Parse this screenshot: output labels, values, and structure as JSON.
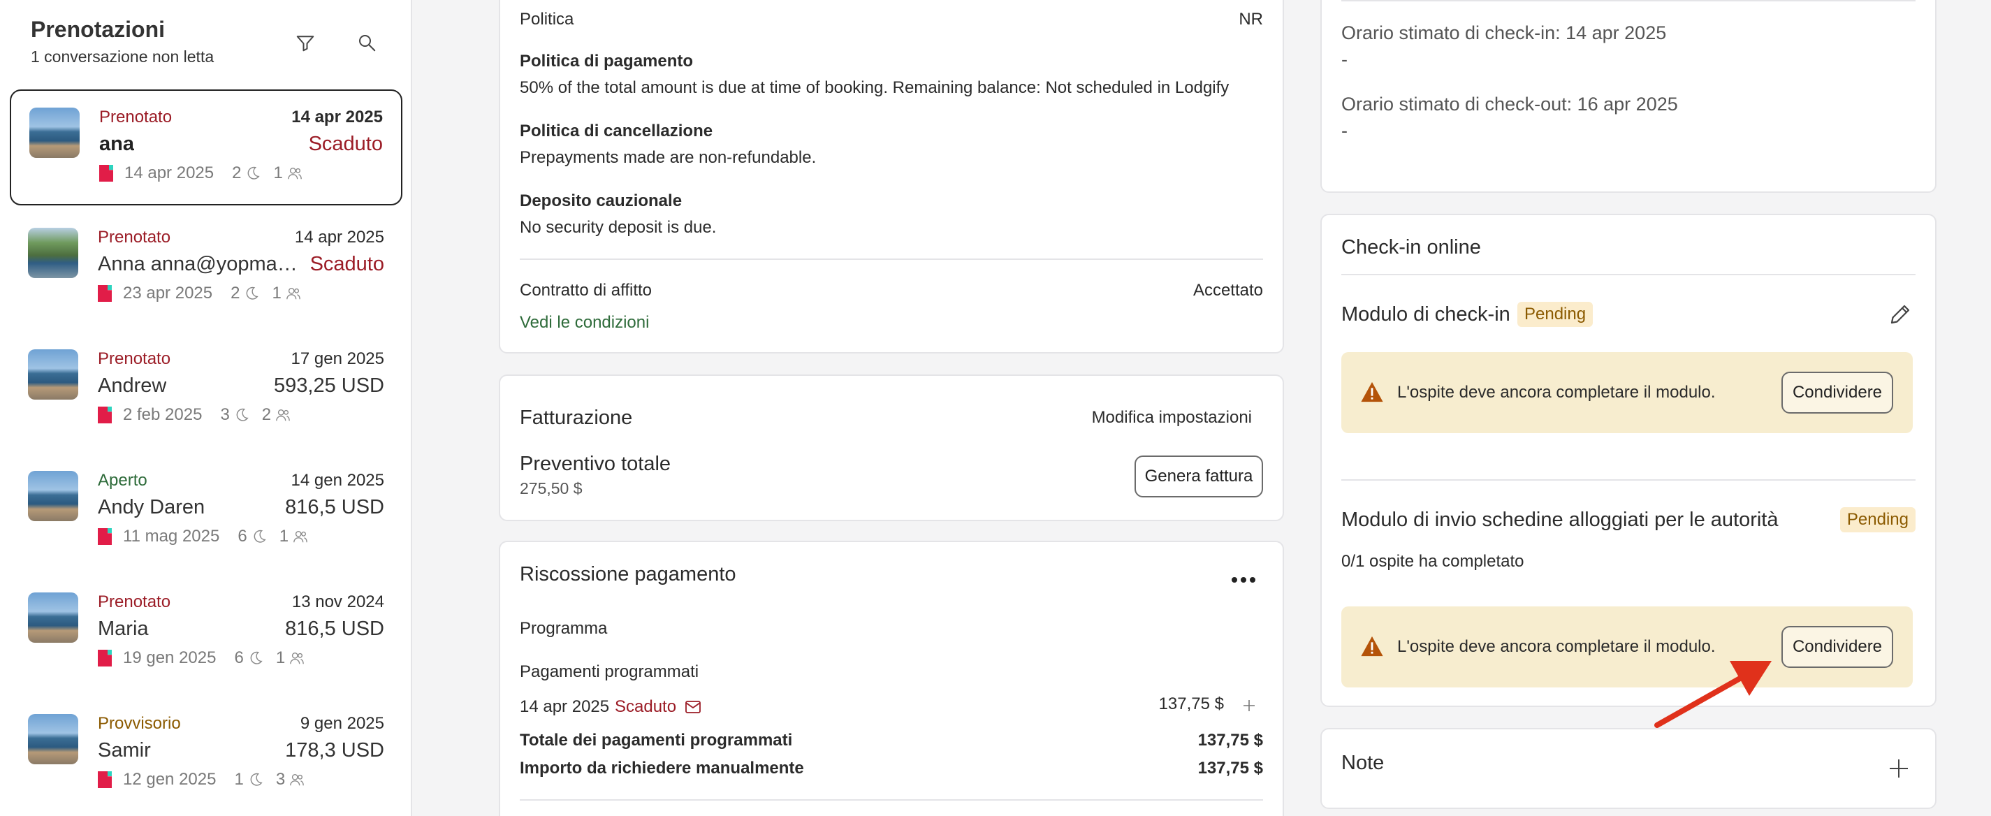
{
  "sidebar": {
    "title": "Prenotazioni",
    "subtitle": "1 conversazione non letta",
    "reservations": [
      {
        "status": "Prenotato",
        "date": "14 apr 2025",
        "guest": "ana",
        "amount": "Scaduto",
        "checkin": "14 apr 2025",
        "nights": "2",
        "guests": "1"
      },
      {
        "status": "Prenotato",
        "date": "14 apr 2025",
        "guest": "Anna anna@yopmail.com",
        "amount": "Scaduto",
        "checkin": "23 apr 2025",
        "nights": "2",
        "guests": "1"
      },
      {
        "status": "Prenotato",
        "date": "17 gen 2025",
        "guest": "Andrew",
        "amount": "593,25 USD",
        "checkin": "2 feb 2025",
        "nights": "3",
        "guests": "2"
      },
      {
        "status": "Aperto",
        "date": "14 gen 2025",
        "guest": "Andy Daren",
        "amount": "816,5 USD",
        "checkin": "11 mag 2025",
        "nights": "6",
        "guests": "1"
      },
      {
        "status": "Prenotato",
        "date": "13 nov 2024",
        "guest": "Maria",
        "amount": "816,5 USD",
        "checkin": "19 gen 2025",
        "nights": "6",
        "guests": "1"
      },
      {
        "status": "Provvisorio",
        "date": "9 gen 2025",
        "guest": "Samir",
        "amount": "178,3 USD",
        "checkin": "12 gen 2025",
        "nights": "1",
        "guests": "3"
      }
    ]
  },
  "policies": {
    "policy_label": "Politica",
    "policy_value": "NR",
    "payment_title": "Politica di pagamento",
    "payment_text": "50% of the total amount is due at time of booking. Remaining balance: Not scheduled in Lodgify",
    "cancel_title": "Politica di cancellazione",
    "cancel_text": "Prepayments made are non-refundable.",
    "deposit_title": "Deposito cauzionale",
    "deposit_text": "No security deposit is due.",
    "contract_label": "Contratto di affitto",
    "contract_value": "Accettato",
    "terms_link": "Vedi le condizioni"
  },
  "billing": {
    "title": "Fatturazione",
    "settings_link": "Modifica impostazioni",
    "quote_label": "Preventivo totale",
    "quote_value": "275,50 $",
    "invoice_button": "Genera fattura"
  },
  "payment": {
    "title": "Riscossione pagamento",
    "program_label": "Programma",
    "scheduled_label": "Pagamenti programmati",
    "row_date": "14 apr 2025",
    "row_status": "Scaduto",
    "row_amount": "137,75 $",
    "total_label": "Totale dei pagamenti programmati",
    "total_value": "137,75 $",
    "manual_label": "Importo da richiedere manualmente",
    "manual_value": "137,75 $"
  },
  "arrival": {
    "checkin_label": "Orario stimato di check-in: 14 apr 2025",
    "checkin_value": "-",
    "checkout_label": "Orario stimato di check-out: 16 apr 2025",
    "checkout_value": "-"
  },
  "online_checkin": {
    "title": "Check-in online",
    "form_label": "Modulo di check-in",
    "form_status": "Pending",
    "warning_1": "L'ospite deve ancora completare il modulo.",
    "share_1": "Condividere",
    "authority_label": "Modulo di invio schedine alloggiati per le autorità",
    "authority_status": "Pending",
    "completed": "0/1 ospite ha completato",
    "warning_2": "L'ospite deve ancora completare il modulo.",
    "share_2": "Condividere"
  },
  "notes": {
    "title": "Note"
  },
  "colors": {
    "accent_red": "#9b1c26",
    "accent_green": "#2e6b3a",
    "warning_bg": "#f7edcf",
    "pending_badge": "#fbeccc",
    "annotation_arrow": "#e0311b"
  }
}
